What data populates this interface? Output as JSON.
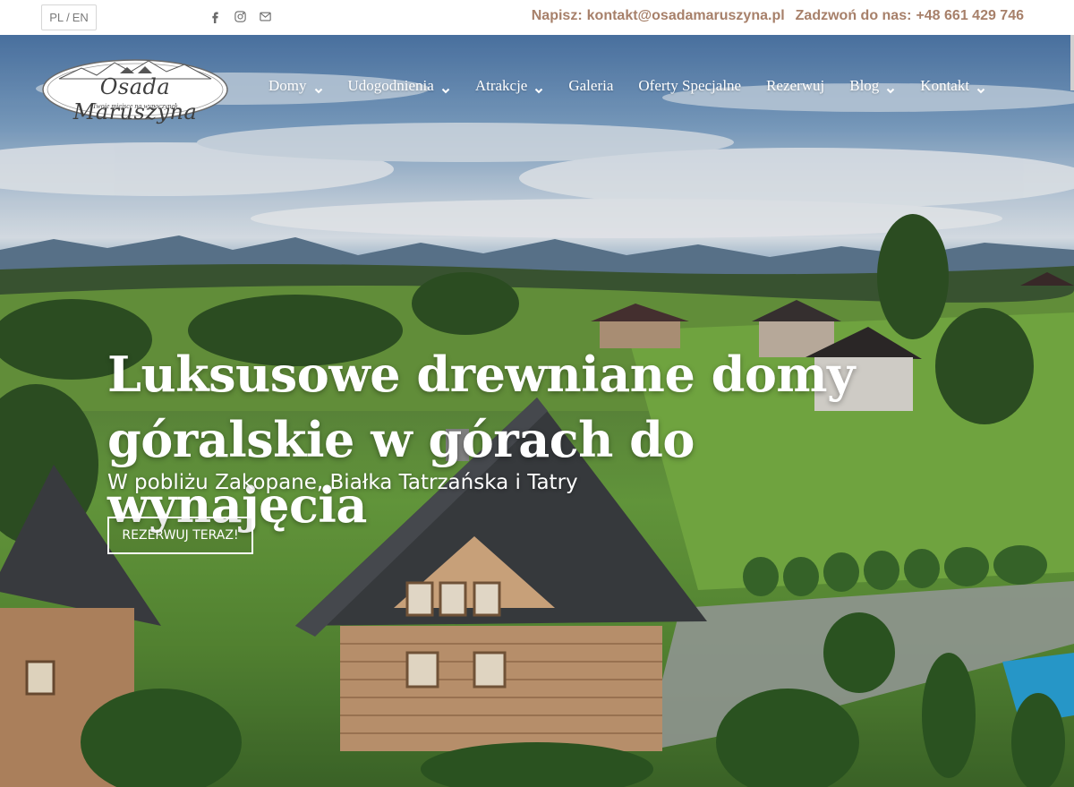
{
  "topbar": {
    "lang": {
      "pl": "PL",
      "sep": "/",
      "en": "EN"
    },
    "socials": [
      {
        "icon": "facebook-icon"
      },
      {
        "icon": "instagram-icon"
      },
      {
        "icon": "mail-icon"
      }
    ],
    "write_label": "Napisz:",
    "email": "kontakt@osadamaruszyna.pl",
    "call_label": "Zadzwoń do nas:",
    "phone": "+48 661 429 746"
  },
  "logo": {
    "name": "Osada Maruszyna",
    "tagline": "Twoje miejsce na wypoczynek"
  },
  "nav": [
    {
      "label": "Domy",
      "dropdown": true
    },
    {
      "label": "Udogodnienia",
      "dropdown": true
    },
    {
      "label": "Atrakcje",
      "dropdown": true
    },
    {
      "label": "Galeria",
      "dropdown": false
    },
    {
      "label": "Oferty Specjalne",
      "dropdown": false
    },
    {
      "label": "Rezerwuj",
      "dropdown": false
    },
    {
      "label": "Blog",
      "dropdown": true
    },
    {
      "label": "Kontakt",
      "dropdown": true
    }
  ],
  "hero": {
    "title_line1": "Luksusowe drewniane domy",
    "title_line2": "góralskie w górach do wynajęcia",
    "subtitle": "W pobliżu Zakopane, Białka Tatrzańska i Tatry",
    "cta": "REZERWUJ TERAZ!"
  },
  "colors": {
    "accent": "#a7806a",
    "topbar_bg": "#ffffff",
    "text_light": "#ffffff"
  }
}
